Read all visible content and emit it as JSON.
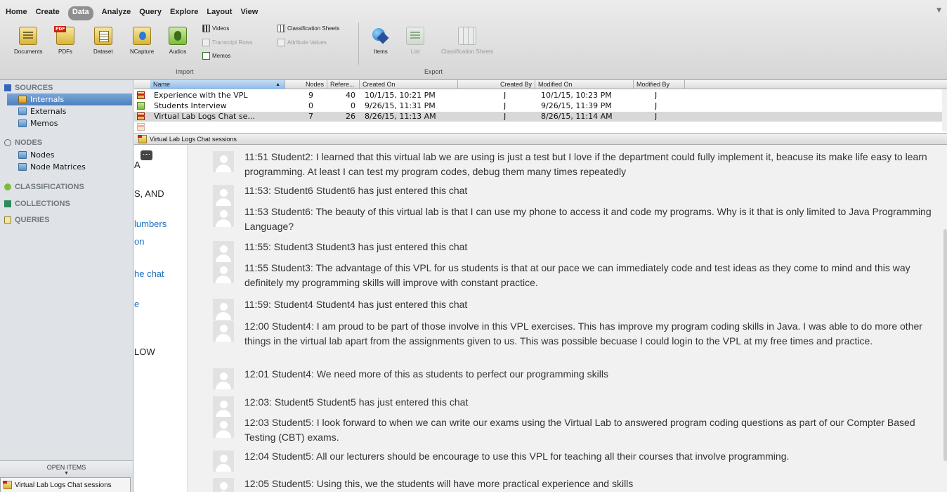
{
  "ribbon": {
    "tabs": [
      "Home",
      "Create",
      "Data",
      "Analyze",
      "Query",
      "Explore",
      "Layout",
      "View"
    ],
    "active_tab": "Data",
    "import": {
      "group_label": "Import",
      "large_buttons": [
        "Documents",
        "PDFs",
        "Dataset",
        "NCapture",
        "Audios"
      ],
      "small_items": [
        "Videos",
        "Transcript Rows",
        "Memos",
        "Classification Sheets",
        "Attribute Values"
      ]
    },
    "export": {
      "group_label": "Export",
      "buttons": [
        "Items",
        "List",
        "Classification Sheets"
      ]
    }
  },
  "sidebar": {
    "sources_label": "SOURCES",
    "sources": [
      "Internals",
      "Externals",
      "Memos"
    ],
    "selected_source": "Internals",
    "nodes_label": "NODES",
    "nodes": [
      "Nodes",
      "Node Matrices"
    ],
    "classifications_label": "CLASSIFICATIONS",
    "collections_label": "COLLECTIONS",
    "queries_label": "QUERIES",
    "open_items_label": "OPEN ITEMS",
    "open_item": "Virtual Lab Logs Chat sessions"
  },
  "list": {
    "columns": [
      "Name",
      "Nodes",
      "Refere...",
      "Created On",
      "Created By",
      "Modified On",
      "Modified By"
    ],
    "rows": [
      {
        "name": "Experience with the VPL",
        "nodes": "9",
        "refs": "40",
        "created_on": "10/1/15, 10:21 PM",
        "created_by": "J",
        "modified_on": "10/1/15, 10:23 PM",
        "modified_by": "J",
        "icon": "pdf-doc-icon"
      },
      {
        "name": "Students Interview",
        "nodes": "0",
        "refs": "0",
        "created_on": "9/26/15, 11:31 PM",
        "created_by": "J",
        "modified_on": "9/26/15, 11:39 PM",
        "modified_by": "J",
        "icon": "audio-doc-icon"
      },
      {
        "name": "Virtual Lab Logs Chat se...",
        "nodes": "7",
        "refs": "26",
        "created_on": "8/26/15, 11:13 AM",
        "created_by": "J",
        "modified_on": "8/26/15, 11:14 AM",
        "modified_by": "J",
        "icon": "pdf-doc-icon"
      }
    ],
    "selected_row": 2
  },
  "detail": {
    "tab_label": "Virtual Lab Logs Chat sessions",
    "left_fragments": [
      "A",
      "S, AND",
      "lumbers",
      "on",
      "he chat",
      "e",
      "LOW"
    ],
    "messages": [
      "11:51 Student2: I learned that this virtual lab we are using is just a test but I love if the department could fully implement it, beacuse its make life easy to learn programming. At least I can test my program codes, debug them many times repeatedly",
      "11:53: Student6 Student6 has just entered this chat",
      "11:53 Student6: The beauty of this virtual lab is that I can use my phone to access it and code my programs. Why is it that is only limited to Java Programming Language?",
      "11:55: Student3 Student3 has just entered this chat",
      "11:55 Student3: The advantage of this VPL for us students is that at our pace we can immediately code and test ideas as they come to mind and this way definitely my programming skills will improve with constant practice.",
      "11:59: Student4 Student4 has just entered this chat",
      "12:00 Student4: I am proud to be part of those involve in this VPL exercises. This has improve my program coding skills in Java. I was able to do more other things in the virtual lab apart from the assignments given to us. This was possible becuase I could login to the VPL at my free times and practice.",
      "12:01 Student4: We need more of this as students to perfect our programming skills",
      "12:03: Student5 Student5 has just entered this chat",
      "12:03 Student5: I look forward to when we can write our exams using the Virtual Lab to answered program coding questions as part of our Compter Based Testing (CBT) exams.",
      "12:04 Student5: All our lecturers should be encourage to use this VPL for teaching all their courses that involve programming.",
      "12:05 Student5: Using this, we the students will have more practical experience and skills"
    ]
  }
}
